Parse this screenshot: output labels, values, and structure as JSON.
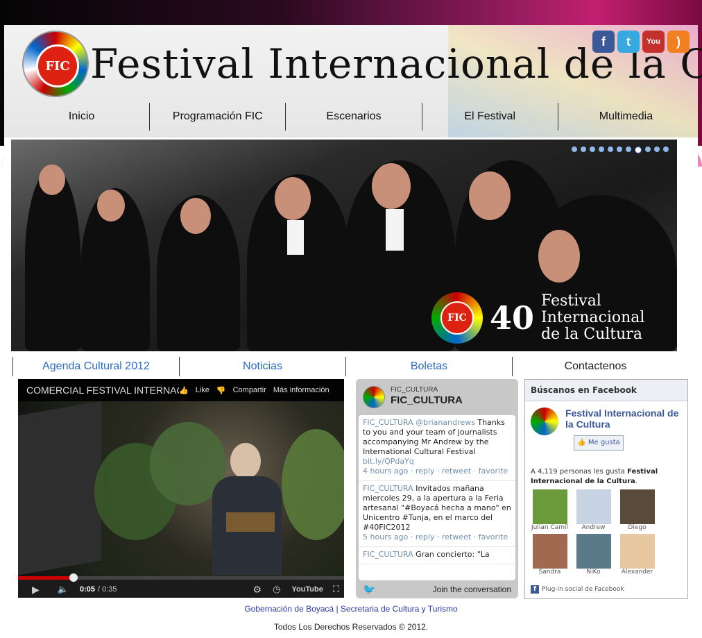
{
  "header": {
    "logo_seal_text": "FIC",
    "logo_title": "Festival Internacional de la Cultura"
  },
  "social": [
    {
      "icon": "facebook-icon",
      "glyph": "f",
      "color": "#3b5998"
    },
    {
      "icon": "twitter-icon",
      "glyph": "t",
      "color": "#38a8e0"
    },
    {
      "icon": "youtube-icon",
      "glyph": "You",
      "color": "#c4302b"
    },
    {
      "icon": "rss-icon",
      "glyph": ")",
      "color": "#f08020"
    }
  ],
  "nav": [
    "Inicio",
    "Programación FIC",
    "Escenarios",
    "El Festival",
    "Multimedia"
  ],
  "hero": {
    "dot_count": 11,
    "active_dot": 7,
    "badge_seal": "FIC",
    "badge_number": "40",
    "badge_text": "Festival Internacional de la Cultura"
  },
  "subnav": [
    "Agenda Cultural 2012",
    "Noticias",
    "Boletas",
    "Contactenos"
  ],
  "video": {
    "title": "COMERCIAL FESTIVAL INTERNACIONAL",
    "like": "Like",
    "share": "Compartir",
    "more": "Más información",
    "time_current": "0:05",
    "time_total": "/ 0:35",
    "progress": 0.17,
    "brand": "YouTube"
  },
  "twitter": {
    "handle_small": "FIC_CULTURA",
    "handle": "FIC_CULTURA",
    "tweets": [
      {
        "user": "FIC_CULTURA",
        "mention": "@brianandrews",
        "text": "Thanks to you and your team of journalists accompanying Mr Andrew by the International Cultural Festival",
        "link": "bit.ly/QPdaYq",
        "meta": "4 hours ago · reply · retweet · favorite"
      },
      {
        "user": "FIC_CULTURA",
        "mention": "",
        "text": "Invitados mañana miercoles 29, a la apertura a la Feria artesanal \"#Boyacá hecha a mano\" en Unicentro #Tunja, en el marco del #40FIC2012",
        "link": "",
        "meta": "5 hours ago · reply · retweet · favorite"
      },
      {
        "user": "FIC_CULTURA",
        "mention": "",
        "text": "Gran concierto: \"La",
        "link": "",
        "meta": ""
      }
    ],
    "join": "Join the conversation"
  },
  "facebook": {
    "header": "Búscanos en Facebook",
    "page_name": "Festival Internacional de la Cultura",
    "like_button": "Me gusta",
    "count_prefix": "A 4,119 personas les gusta",
    "count_page": "Festival Internacional de la Cultura",
    "friends": [
      {
        "name": "Julian Camil",
        "color": "#6a9a3a"
      },
      {
        "name": "Andrew",
        "color": "#c8d4e4"
      },
      {
        "name": "Diego",
        "color": "#5a4a3a"
      },
      {
        "name": "Sandra",
        "color": "#a06a50"
      },
      {
        "name": "NiKo",
        "color": "#5a7a8a"
      },
      {
        "name": "Alexander",
        "color": "#e8c8a0"
      }
    ],
    "plugin_note": "Plug-in social de Facebook"
  },
  "footer": {
    "link1": "Gobernación de Boyacá",
    "separator": "|",
    "link2": "Secretaria de Cultura y Turismo",
    "copyright": "Todos Los Derechos Reservados © 2012."
  }
}
